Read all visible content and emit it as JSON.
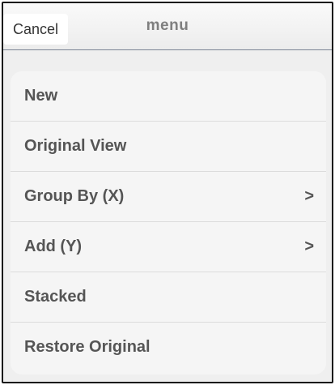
{
  "navbar": {
    "cancel_label": "Cancel",
    "title": "menu"
  },
  "menu": {
    "items": [
      {
        "label": "New",
        "has_submenu": false
      },
      {
        "label": "Original View",
        "has_submenu": false
      },
      {
        "label": "Group By (X)",
        "has_submenu": true,
        "chevron": ">"
      },
      {
        "label": "Add (Y)",
        "has_submenu": true,
        "chevron": ">"
      },
      {
        "label": "Stacked",
        "has_submenu": false
      },
      {
        "label": "Restore Original",
        "has_submenu": false
      }
    ]
  },
  "colors": {
    "background": "#efefef",
    "card": "#f5f5f5",
    "text": "#555555",
    "title": "#7f7f7f",
    "divider": "#dcdcdc",
    "navbar_border": "#7b8394"
  }
}
